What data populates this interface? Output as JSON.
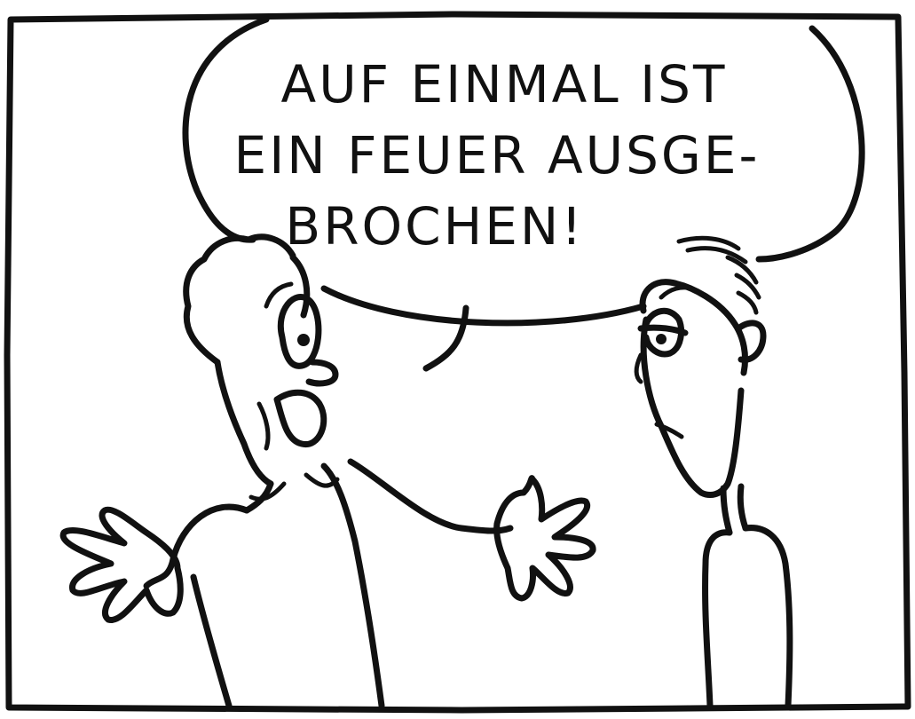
{
  "speech_bubble": {
    "lines": [
      "AUF EINMAL IST",
      "EIN FEUER AUSGE-",
      "BROCHEN!"
    ]
  }
}
